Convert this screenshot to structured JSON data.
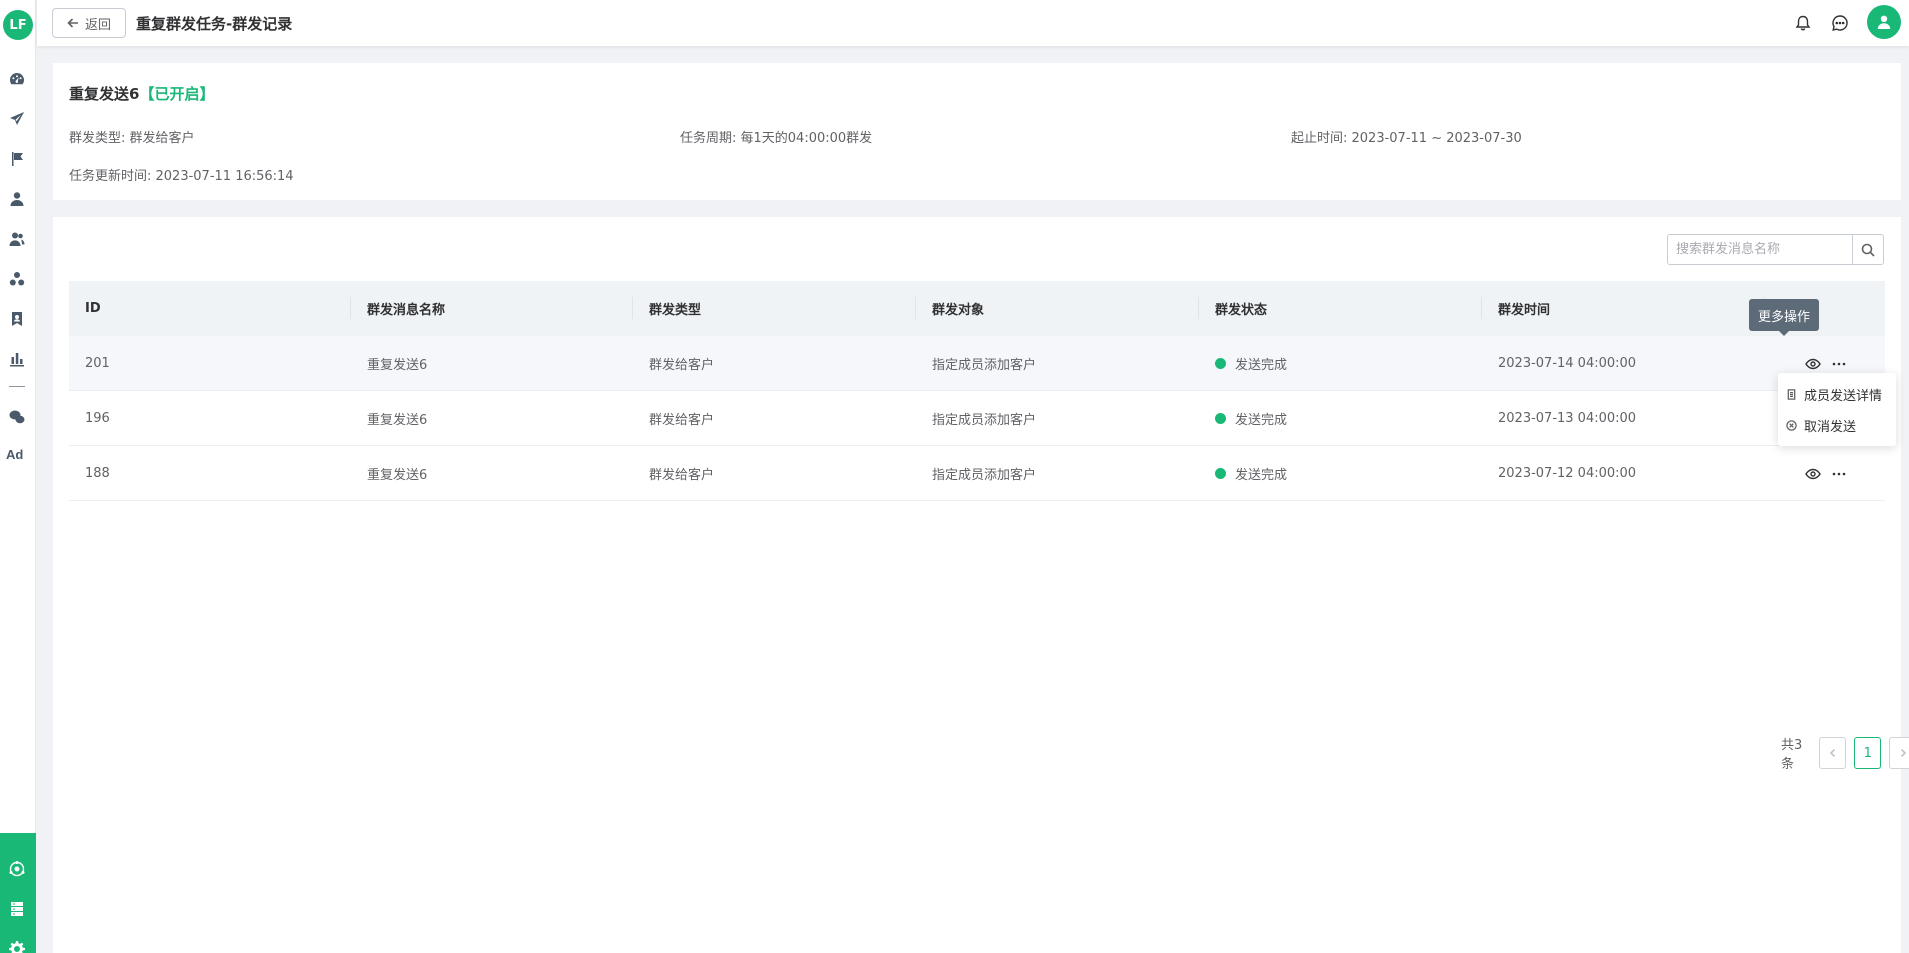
{
  "app": {
    "logo_text": "LF",
    "accent_color": "#1ab877",
    "sidebar_ad_label": "Ad"
  },
  "header": {
    "back_label": "返回",
    "title": "重复群发任务-群发记录"
  },
  "info": {
    "task_name": "重复发送6",
    "task_status": "【已开启】",
    "send_type": "群发类型: 群发给客户",
    "period": "任务周期: 每1天的04:00:00群发",
    "range": "起止时间: 2023-07-11 ~ 2023-07-30",
    "updated": "任务更新时间: 2023-07-11 16:56:14"
  },
  "search": {
    "placeholder": "搜索群发消息名称",
    "value": ""
  },
  "table": {
    "headers": [
      "ID",
      "群发消息名称",
      "群发类型",
      "群发对象",
      "群发状态",
      "群发时间",
      ""
    ],
    "rows": [
      {
        "id": "201",
        "name": "重复发送6",
        "type": "群发给客户",
        "target": "指定成员添加客户",
        "status": "发送完成",
        "time": "2023-07-14 04:00:00"
      },
      {
        "id": "196",
        "name": "重复发送6",
        "type": "群发给客户",
        "target": "指定成员添加客户",
        "status": "发送完成",
        "time": "2023-07-13 04:00:00"
      },
      {
        "id": "188",
        "name": "重复发送6",
        "type": "群发给客户",
        "target": "指定成员添加客户",
        "status": "发送完成",
        "time": "2023-07-12 04:00:00"
      }
    ]
  },
  "tooltip": {
    "text": "更多操作"
  },
  "dropdown": {
    "items": [
      "成员发送详情",
      "取消发送"
    ]
  },
  "pagination": {
    "total": "共3条",
    "current": "1"
  }
}
